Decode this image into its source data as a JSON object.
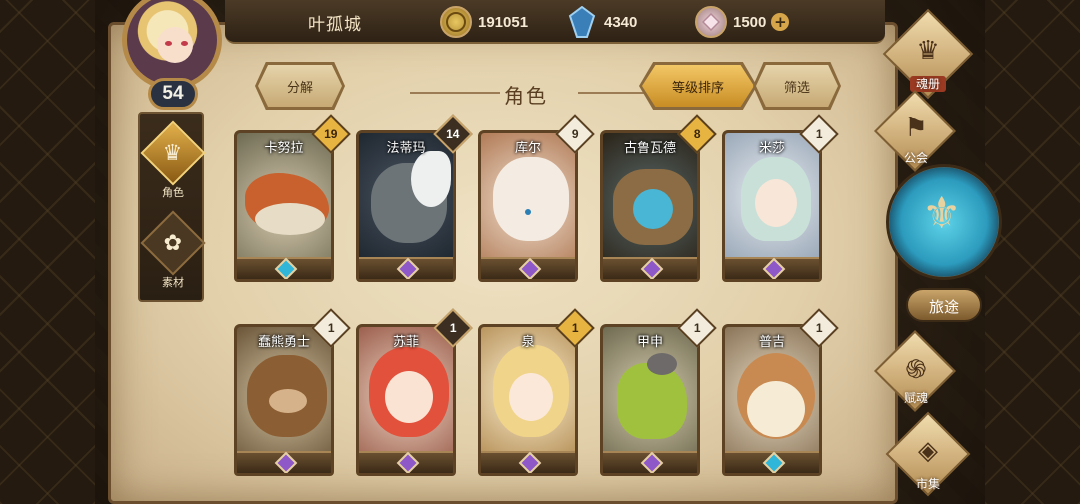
{
  "player": {
    "name": "叶孤城",
    "level": "54"
  },
  "currencies": {
    "gold": "191051",
    "crystal": "4340",
    "shard": "1500"
  },
  "left_nav": [
    {
      "label": "角色",
      "icon": "helmet-icon",
      "active": true
    },
    {
      "label": "素材",
      "icon": "material-icon",
      "active": false
    }
  ],
  "panel": {
    "title": "角色",
    "decompose_label": "分解",
    "sort_label": "等级排序",
    "filter_label": "筛选"
  },
  "characters": [
    {
      "name": "卡努拉",
      "level": "19",
      "badge": "gold",
      "gem": "blue"
    },
    {
      "name": "法蒂玛",
      "level": "14",
      "badge": "dark",
      "gem": "purple"
    },
    {
      "name": "库尔",
      "level": "9",
      "badge": "white",
      "gem": "purple"
    },
    {
      "name": "古鲁瓦德",
      "level": "8",
      "badge": "gold",
      "gem": "purple"
    },
    {
      "name": "米莎",
      "level": "1",
      "badge": "white",
      "gem": "purple"
    },
    {
      "name": "蠢熊勇士",
      "level": "1",
      "badge": "white",
      "gem": "purple"
    },
    {
      "name": "苏菲",
      "level": "1",
      "badge": "dark",
      "gem": "purple"
    },
    {
      "name": "泉",
      "level": "1",
      "badge": "gold",
      "gem": "purple"
    },
    {
      "name": "甲申",
      "level": "1",
      "badge": "white",
      "gem": "purple"
    },
    {
      "name": "普吉",
      "level": "1",
      "badge": "white",
      "gem": "blue"
    }
  ],
  "right_nav": {
    "soul_book": "魂册",
    "guild": "公会",
    "journey": "旅途",
    "endow_soul": "赋魂",
    "market": "市集"
  }
}
